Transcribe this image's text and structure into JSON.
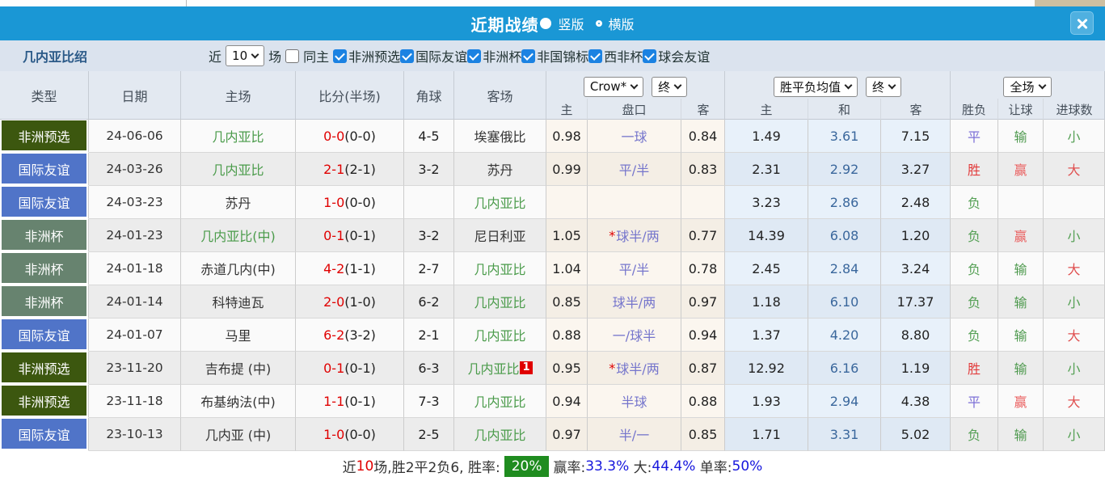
{
  "header": {
    "title": "近期战绩",
    "radio_vertical": "竖版",
    "radio_horizontal": "横版"
  },
  "filter": {
    "team_intro": "几内亚比绍",
    "recent_label": "近",
    "recent_value": "10",
    "matches_label": "场",
    "same_home_label": "同主",
    "competitions": [
      "非洲预选",
      "国际友谊",
      "非洲杯",
      "非国锦标",
      "西非杯",
      "球会友谊"
    ]
  },
  "table": {
    "left_headers": [
      "类型",
      "日期",
      "主场",
      "比分(半场)",
      "角球",
      "客场"
    ],
    "dropdowns": {
      "company": "Crow*",
      "company_time": "终",
      "wdl": "胜平负均值",
      "wdl_time": "终",
      "scope": "全场"
    },
    "sub_headers": {
      "crow": [
        "主",
        "盘口",
        "客"
      ],
      "wdl": [
        "主",
        "和",
        "客"
      ],
      "result": [
        "胜负",
        "让球",
        "进球数"
      ]
    },
    "rows": [
      {
        "type": "非洲预选",
        "date": "24-06-06",
        "home": {
          "name": "几内亚比",
          "green": true
        },
        "score_ft": "0-0",
        "score_ht": "(0-0)",
        "corners": "4-5",
        "away": {
          "name": "埃塞俄比",
          "green": false,
          "badge": ""
        },
        "crow_home": "0.98",
        "handicap": "一球",
        "handicap_star": false,
        "crow_away": "0.84",
        "odds_home": "1.49",
        "odds_draw": "3.61",
        "odds_away": "7.15",
        "res_outcome": "平",
        "res_handicap": "输",
        "res_goals": "小"
      },
      {
        "type": "国际友谊",
        "date": "24-03-26",
        "home": {
          "name": "几内亚比",
          "green": true
        },
        "score_ft": "2-1",
        "score_ht": "(2-1)",
        "corners": "3-2",
        "away": {
          "name": "苏丹",
          "green": false,
          "badge": ""
        },
        "crow_home": "0.99",
        "handicap": "平/半",
        "handicap_star": false,
        "crow_away": "0.83",
        "odds_home": "2.31",
        "odds_draw": "2.92",
        "odds_away": "3.27",
        "res_outcome": "胜",
        "res_handicap": "赢",
        "res_goals": "大"
      },
      {
        "type": "国际友谊",
        "date": "24-03-23",
        "home": {
          "name": "苏丹",
          "green": false
        },
        "score_ft": "1-0",
        "score_ht": "(0-0)",
        "corners": "",
        "away": {
          "name": "几内亚比",
          "green": true,
          "badge": ""
        },
        "crow_home": "",
        "handicap": "",
        "handicap_star": false,
        "crow_away": "",
        "odds_home": "3.23",
        "odds_draw": "2.86",
        "odds_away": "2.48",
        "res_outcome": "负",
        "res_handicap": "",
        "res_goals": ""
      },
      {
        "type": "非洲杯",
        "date": "24-01-23",
        "home": {
          "name": "几内亚比(中)",
          "green": true
        },
        "score_ft": "0-1",
        "score_ht": "(0-1)",
        "corners": "3-2",
        "away": {
          "name": "尼日利亚",
          "green": false,
          "badge": ""
        },
        "crow_home": "1.05",
        "handicap": "球半/两",
        "handicap_star": true,
        "crow_away": "0.77",
        "odds_home": "14.39",
        "odds_draw": "6.08",
        "odds_away": "1.20",
        "res_outcome": "负",
        "res_handicap": "赢",
        "res_goals": "小"
      },
      {
        "type": "非洲杯",
        "date": "24-01-18",
        "home": {
          "name": "赤道几内(中)",
          "green": false
        },
        "score_ft": "4-2",
        "score_ht": "(1-1)",
        "corners": "2-7",
        "away": {
          "name": "几内亚比",
          "green": true,
          "badge": ""
        },
        "crow_home": "1.04",
        "handicap": "平/半",
        "handicap_star": false,
        "crow_away": "0.78",
        "odds_home": "2.45",
        "odds_draw": "2.84",
        "odds_away": "3.24",
        "res_outcome": "负",
        "res_handicap": "输",
        "res_goals": "大"
      },
      {
        "type": "非洲杯",
        "date": "24-01-14",
        "home": {
          "name": "科特迪瓦",
          "green": false
        },
        "score_ft": "2-0",
        "score_ht": "(1-0)",
        "corners": "6-2",
        "away": {
          "name": "几内亚比",
          "green": true,
          "badge": ""
        },
        "crow_home": "0.85",
        "handicap": "球半/两",
        "handicap_star": false,
        "crow_away": "0.97",
        "odds_home": "1.18",
        "odds_draw": "6.10",
        "odds_away": "17.37",
        "res_outcome": "负",
        "res_handicap": "输",
        "res_goals": "小"
      },
      {
        "type": "国际友谊",
        "date": "24-01-07",
        "home": {
          "name": "马里",
          "green": false
        },
        "score_ft": "6-2",
        "score_ht": "(3-2)",
        "corners": "2-1",
        "away": {
          "name": "几内亚比",
          "green": true,
          "badge": ""
        },
        "crow_home": "0.88",
        "handicap": "一/球半",
        "handicap_star": false,
        "crow_away": "0.94",
        "odds_home": "1.37",
        "odds_draw": "4.20",
        "odds_away": "8.80",
        "res_outcome": "负",
        "res_handicap": "输",
        "res_goals": "大"
      },
      {
        "type": "非洲预选",
        "date": "23-11-20",
        "home": {
          "name": "吉布提 (中)",
          "green": false
        },
        "score_ft": "0-1",
        "score_ht": "(0-1)",
        "corners": "6-3",
        "away": {
          "name": "几内亚比",
          "green": true,
          "badge": "1"
        },
        "crow_home": "0.95",
        "handicap": "球半/两",
        "handicap_star": true,
        "crow_away": "0.87",
        "odds_home": "12.92",
        "odds_draw": "6.16",
        "odds_away": "1.19",
        "res_outcome": "胜",
        "res_handicap": "输",
        "res_goals": "小"
      },
      {
        "type": "非洲预选",
        "date": "23-11-18",
        "home": {
          "name": "布基纳法(中)",
          "green": false
        },
        "score_ft": "1-1",
        "score_ht": "(0-1)",
        "corners": "7-3",
        "away": {
          "name": "几内亚比",
          "green": true,
          "badge": ""
        },
        "crow_home": "0.94",
        "handicap": "半球",
        "handicap_star": false,
        "crow_away": "0.88",
        "odds_home": "1.93",
        "odds_draw": "2.94",
        "odds_away": "4.38",
        "res_outcome": "平",
        "res_handicap": "赢",
        "res_goals": "大"
      },
      {
        "type": "国际友谊",
        "date": "23-10-13",
        "home": {
          "name": "几内亚 (中)",
          "green": false
        },
        "score_ft": "1-0",
        "score_ht": "(0-0)",
        "corners": "2-5",
        "away": {
          "name": "几内亚比",
          "green": true,
          "badge": ""
        },
        "crow_home": "0.97",
        "handicap": "半/一",
        "handicap_star": false,
        "crow_away": "0.85",
        "odds_home": "1.71",
        "odds_draw": "3.31",
        "odds_away": "5.02",
        "res_outcome": "负",
        "res_handicap": "输",
        "res_goals": "小"
      }
    ]
  },
  "summary": {
    "segments": [
      {
        "text": "近",
        "style": "dark"
      },
      {
        "text": "10",
        "style": "red"
      },
      {
        "text": "场,胜2平2负6, 胜率:",
        "style": "dark"
      },
      {
        "text": "20%",
        "style": "badge"
      },
      {
        "text": "赢率:",
        "style": "dark"
      },
      {
        "text": "33.3%",
        "style": "blue"
      },
      {
        "text": " 大:",
        "style": "dark"
      },
      {
        "text": "44.4%",
        "style": "blue"
      },
      {
        "text": " 单率:",
        "style": "dark"
      },
      {
        "text": "50%",
        "style": "blue"
      }
    ]
  },
  "colors": {
    "titlebar_blue": "#1a97d5",
    "type_badges": {
      "非洲预选": "#3c570f",
      "国际友谊": "#5074c8",
      "非洲杯": "#67836f"
    },
    "team_green": "#4a9b4a",
    "team_dark": "#333333",
    "score_red": "#e00000",
    "handicap_purple": "#7575cc",
    "draw_odds_blue": "#3a679c",
    "result": {
      "胜": "#e23b3b",
      "平": "#7b6ed6",
      "负": "#55a055",
      "赢": "#ea5f5f",
      "输": "#4f9a4f",
      "大": "#e05050",
      "小": "#55a055"
    },
    "summary_blue": "#1616dd",
    "summary_red": "#e00000",
    "summary_badge_bg": "#1f8c1f"
  }
}
